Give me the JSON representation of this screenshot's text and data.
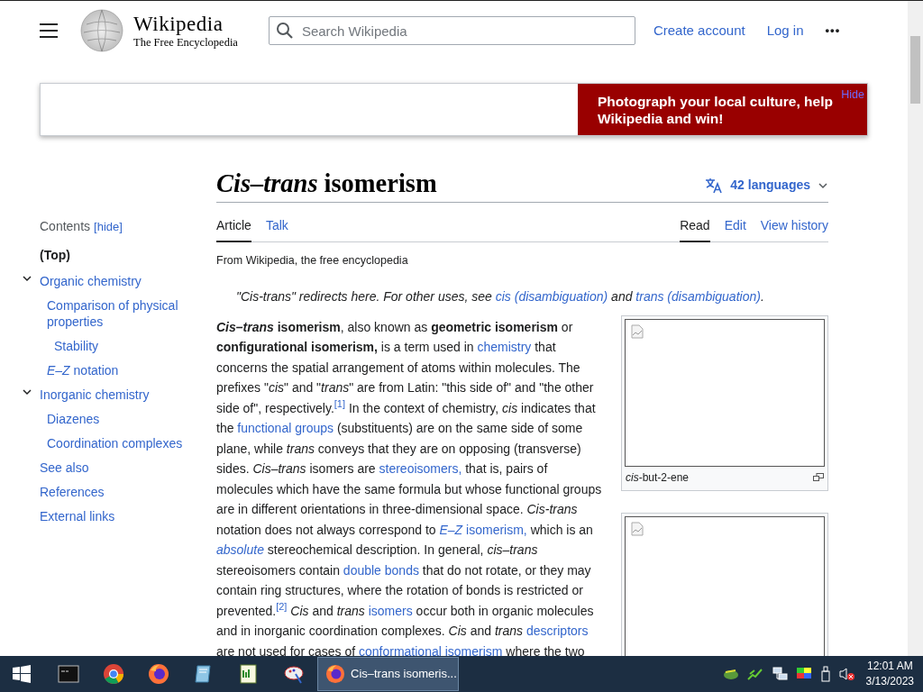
{
  "header": {
    "logo_title": "Wikipedia",
    "logo_tagline": "The Free Encyclopedia",
    "search": {
      "placeholder": "Search Wikipedia"
    },
    "links": [
      "Create account",
      "Log in"
    ],
    "more": "•••"
  },
  "banner": {
    "text": "Photograph your local culture, help Wikipedia and win!",
    "hide": "Hide"
  },
  "toc": {
    "title": "Contents",
    "toggle": "[hide]",
    "items": [
      {
        "label": "(Top)",
        "selected": true
      },
      {
        "label": "Organic chemistry",
        "selected": false,
        "expanded": true,
        "children": [
          {
            "label": "Comparison of physical properties",
            "selected": false,
            "children": [
              {
                "label": "Stability",
                "selected": false
              }
            ]
          },
          {
            "label": "*E–Z* notation",
            "selected": false
          }
        ]
      },
      {
        "label": "Inorganic chemistry",
        "selected": false,
        "expanded": true,
        "children": [
          {
            "label": "Diazenes",
            "selected": false
          },
          {
            "label": "Coordination complexes",
            "selected": false
          }
        ]
      },
      {
        "label": "See also",
        "selected": false
      },
      {
        "label": "References",
        "selected": false
      },
      {
        "label": "External links",
        "selected": false
      }
    ]
  },
  "article": {
    "title": "*Cis–trans* isomerism",
    "languages": "42 languages",
    "tabs_left": [
      {
        "label": "Article",
        "selected": true
      },
      {
        "label": "Talk",
        "selected": false
      }
    ],
    "tabs_right": [
      {
        "label": "Read",
        "selected": true
      },
      {
        "label": "Edit",
        "selected": false
      },
      {
        "label": "View history",
        "selected": false
      }
    ],
    "tagline": "From Wikipedia, the free encyclopedia",
    "hatnote": [
      {
        "kind": "text",
        "text": "\"Cis-trans\" redirects here. For other uses, see "
      },
      {
        "kind": "link",
        "text": "cis (disambiguation)"
      },
      {
        "kind": "text",
        "text": " and "
      },
      {
        "kind": "link",
        "text": "trans (disambiguation)"
      },
      {
        "kind": "text",
        "text": "."
      }
    ],
    "paragraph": [
      {
        "kind": "bold-italic",
        "text": "Cis–trans"
      },
      {
        "kind": "text",
        "text": " **isomerism**, also known as **geometric isomerism** or **configurational isomerism,** is a term used in "
      },
      {
        "kind": "link",
        "text": "chemistry"
      },
      {
        "kind": "text",
        "text": " that concerns the spatial arrangement of atoms within molecules. The prefixes \"*cis*\" and \"*trans*\" are from Latin: \"this side of\" and \"the other side of\", respectively."
      },
      {
        "kind": "ref",
        "text": "[1]"
      },
      {
        "kind": "text",
        "text": " In the context of chemistry, *cis* indicates that the "
      },
      {
        "kind": "link",
        "text": "functional groups"
      },
      {
        "kind": "text",
        "text": " (substituents) are on the same side of some plane, while *trans* conveys that they are on opposing (transverse) sides. *Cis–trans* isomers are "
      },
      {
        "kind": "link",
        "text": "stereoisomers,"
      },
      {
        "kind": "text",
        "text": " that is, pairs of molecules which have the same formula but whose functional groups are in different orientations in three-dimensional space. *Cis-trans* notation does not always correspond to "
      },
      {
        "kind": "link",
        "text": "*E–Z* isomerism,"
      },
      {
        "kind": "text",
        "text": " which is an "
      },
      {
        "kind": "link",
        "text": "*absolute*"
      },
      {
        "kind": "text",
        "text": " stereochemical description. In general, *cis–trans* stereoisomers contain "
      },
      {
        "kind": "link",
        "text": "double bonds"
      },
      {
        "kind": "text",
        "text": " that do not rotate, or they may contain ring structures, where the rotation of bonds is restricted or prevented."
      },
      {
        "kind": "ref",
        "text": "[2]"
      },
      {
        "kind": "text",
        "text": " *Cis* and *trans* "
      },
      {
        "kind": "link",
        "text": "isomers"
      },
      {
        "kind": "text",
        "text": " occur both in organic molecules and in inorganic coordination complexes. *Cis* and *trans* "
      },
      {
        "kind": "link",
        "text": "descriptors"
      },
      {
        "kind": "text",
        "text": " are not used for cases of "
      },
      {
        "kind": "link",
        "text": "conformational isomerism"
      },
      {
        "kind": "text",
        "text": " where the two"
      }
    ],
    "figures": [
      {
        "kind": "captioned",
        "caption": "*cis*-but-2-ene"
      },
      {
        "kind": "uncaptioned"
      }
    ]
  },
  "taskbar": {
    "apps": [
      {
        "kind": "terminal"
      },
      {
        "kind": "chrome"
      },
      {
        "kind": "firefox"
      },
      {
        "kind": "notebook"
      },
      {
        "kind": "notepad"
      },
      {
        "kind": "paint"
      }
    ],
    "window": {
      "label": "Cis–trans isomeris...",
      "selected": true
    },
    "time": "12:01 AM",
    "date": "3/13/2023"
  }
}
